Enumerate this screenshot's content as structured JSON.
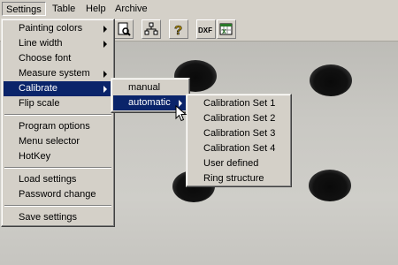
{
  "menubar": {
    "items": [
      "Settings",
      "Table",
      "Help",
      "Archive"
    ]
  },
  "toolbar": {
    "buttons": [
      "page-zoom-icon",
      "tree-network-icon",
      "help-question-icon",
      "dxf-export-icon",
      "excel-export-icon"
    ],
    "dxf_label": "DXF"
  },
  "settings_menu": {
    "items": [
      "Painting colors",
      "Line width",
      "Choose font",
      "Measure system",
      "Calibrate",
      "Flip scale",
      "Program options",
      "Menu selector",
      "HotKey",
      "Load settings",
      "Password change",
      "Save settings"
    ]
  },
  "calibrate_menu": {
    "items": [
      "manual",
      "automatic"
    ]
  },
  "automatic_menu": {
    "items": [
      "Calibration Set 1",
      "Calibration Set 2",
      "Calibration Set 3",
      "Calibration Set 4",
      "User defined",
      "Ring structure"
    ]
  },
  "colors": {
    "highlight": "#0a246a",
    "menu_bg": "#d4d0c8"
  }
}
